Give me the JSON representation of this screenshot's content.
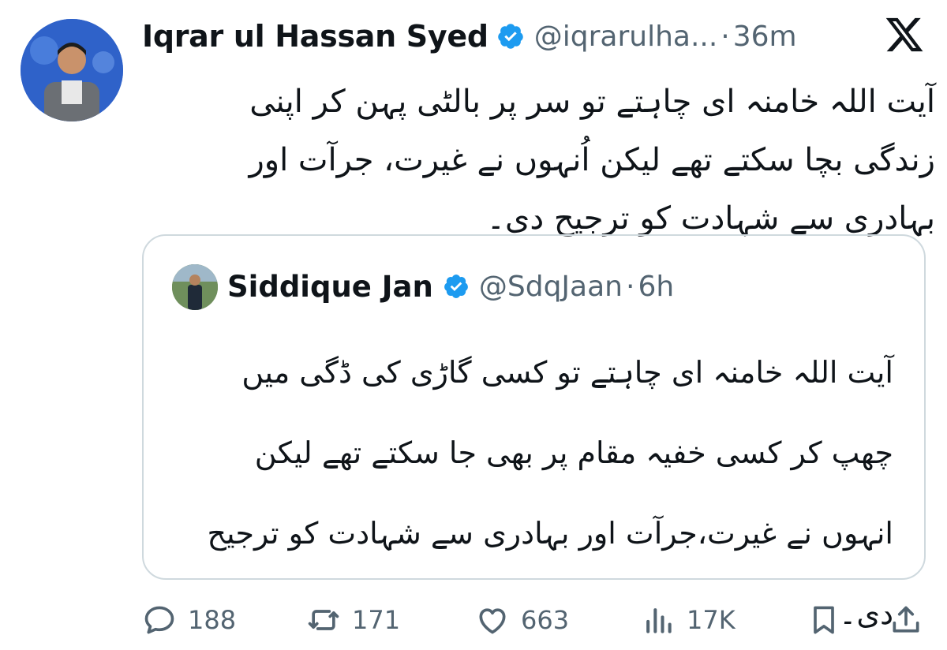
{
  "tweet": {
    "author_name": "Iqrar ul Hassan Syed",
    "handle": "@iqrarulha...",
    "separator": "·",
    "time": "36m",
    "text": "آیت اللہ خامنہ ای چاہتے تو سر پر بالٹی پہن کر اپنی زندگی بچا سکتے تھے لیکن اُنہوں نے غیرت، جرآت اور بہادری سے شہادت کو ترجیح دی۔"
  },
  "quote": {
    "author_name": "Siddique Jan",
    "handle": "@SdqJaan",
    "separator": "·",
    "time": "6h",
    "text": "آیت اللہ خامنہ ای چاہتے تو کسی گاڑی کی ڈگی میں چھپ کر کسی خفیہ مقام پر بھی جا سکتے تھے لیکن انہوں نے غیرت،جرآت اور بہادری سے شہادت کو ترجیح دی۔"
  },
  "actions": {
    "replies": "188",
    "reposts": "171",
    "likes": "663",
    "views": "17K"
  },
  "icons": {
    "verified": "verified-badge-icon",
    "x_logo": "x-logo-icon",
    "reply": "reply-icon",
    "repost": "repost-icon",
    "like": "heart-icon",
    "views": "views-icon",
    "bookmark": "bookmark-icon",
    "share": "share-icon"
  },
  "colors": {
    "text": "#0f1419",
    "secondary": "#536471",
    "verified": "#1d9bf0",
    "border": "#cfd9de"
  }
}
